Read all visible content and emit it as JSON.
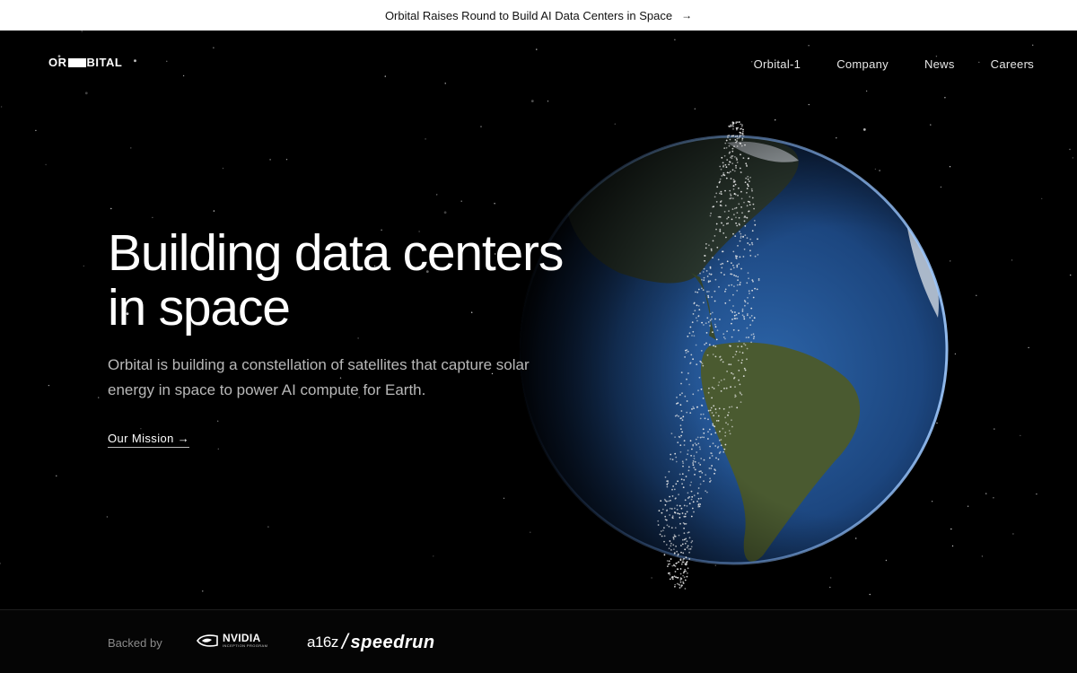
{
  "announcement": {
    "text": "Orbital Raises Round to Build AI Data Centers in Space",
    "arrow": "→"
  },
  "logo": {
    "left": "OR",
    "right": "BITAL"
  },
  "nav": [
    {
      "label": "Orbital-1"
    },
    {
      "label": "Company"
    },
    {
      "label": "News"
    },
    {
      "label": "Careers"
    }
  ],
  "hero": {
    "headline_line1": "Building data centers",
    "headline_line2": "in space",
    "subtext_line1": "Orbital is building a constellation of satellites that capture solar",
    "subtext_line2": "energy in space to power AI compute for Earth.",
    "cta": "Our Mission →"
  },
  "footer": {
    "backed_by": "Backed by",
    "nvidia_word": "NVIDIA",
    "nvidia_sub": "INCEPTION PROGRAM",
    "a16z": "a16z",
    "slash": "/",
    "speedrun": "speedrun"
  },
  "colors": {
    "background": "#000000",
    "banner": "#ffffff",
    "ocean": "#1f4a85",
    "land": "#3f5a2f"
  }
}
